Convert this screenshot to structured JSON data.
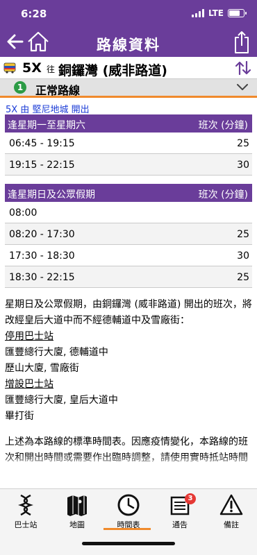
{
  "status_bar": {
    "time": "6:28",
    "network": "LTE"
  },
  "nav": {
    "title": "路線資料",
    "back_icon": "arrow-left-icon",
    "home_icon": "home-icon",
    "share_icon": "share-icon"
  },
  "route": {
    "number": "5X",
    "to_label": "往",
    "destination": "銅鑼灣 (威非路道)"
  },
  "variant": {
    "badge": "1",
    "label": "正常路線"
  },
  "departure": "5X 由 堅尼地城 開出",
  "sections": [
    {
      "title": "逢星期一至星期六",
      "freq_header": "班次 (分鐘)",
      "rows": [
        {
          "time": "06:45 - 19:15",
          "freq": "25"
        },
        {
          "time": "19:15 - 22:15",
          "freq": "30"
        }
      ]
    },
    {
      "title": "逢星期日及公眾假期",
      "freq_header": "班次 (分鐘)",
      "rows": [
        {
          "time": "08:00",
          "freq": ""
        },
        {
          "time": "08:20 - 17:30",
          "freq": "25"
        },
        {
          "time": "17:30 - 18:30",
          "freq": "30"
        },
        {
          "time": "18:30 - 22:15",
          "freq": "25"
        }
      ]
    }
  ],
  "notes": {
    "intro": "星期日及公眾假期，由銅鑼灣 (威非路道) 開出的班次，將改經皇后大道中而不經德輔道中及雪廠街：",
    "cancelled_title": "停用巴士站",
    "cancelled": [
      "匯豐總行大廈, 德輔道中",
      "歷山大廈, 雪廠街"
    ],
    "added_title": "增設巴士站",
    "added": [
      "匯豐總行大廈, 皇后大道中",
      "畢打街"
    ]
  },
  "disclaimer": "上述為本路線的標準時間表。因應疫情變化，本路線的班次和開出時間或需要作出臨時調整，請使用實時抵站時間",
  "tabs": [
    {
      "label": "巴士站",
      "icon": "bus-stops-icon"
    },
    {
      "label": "地圖",
      "icon": "map-icon"
    },
    {
      "label": "時間表",
      "icon": "clock-icon"
    },
    {
      "label": "通告",
      "icon": "notice-icon",
      "badge": "3"
    },
    {
      "label": "備註",
      "icon": "warning-icon"
    }
  ],
  "colors": {
    "primary": "#6a3d9a",
    "accent": "#f08a2c",
    "link": "#1a3bd6",
    "badge_green": "#2c9b45",
    "badge_red": "#e53935"
  }
}
